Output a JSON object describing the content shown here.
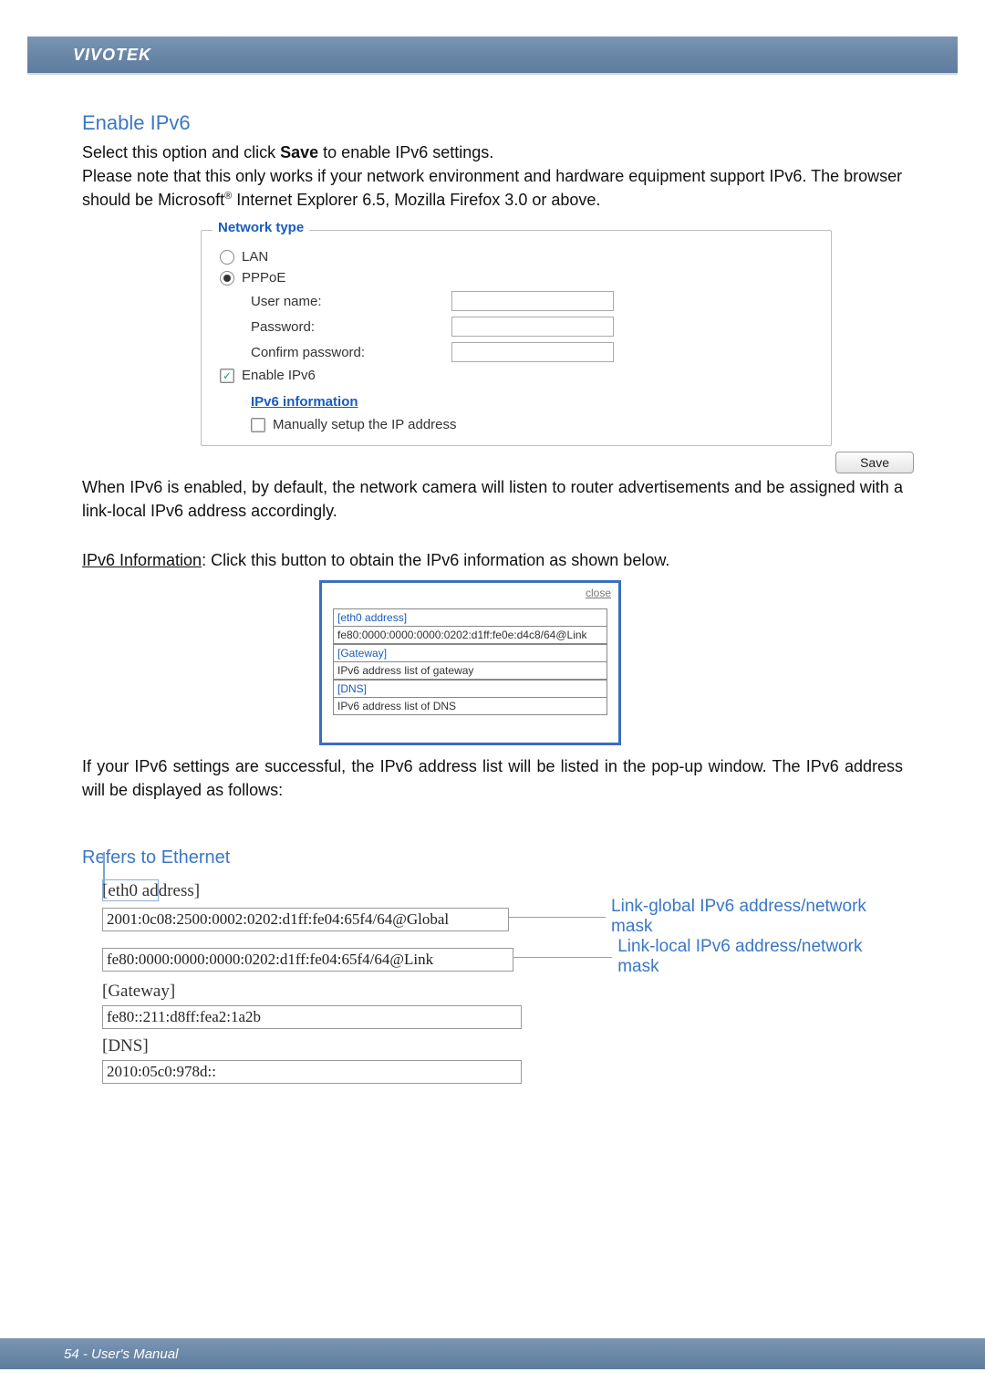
{
  "header": {
    "brand": "VIVOTEK"
  },
  "section": {
    "title": "Enable IPv6",
    "para1_a": "Select this option and click ",
    "para1_save": "Save",
    "para1_b": " to enable IPv6 settings.",
    "para2_a": "Please note that this only works if your network environment and hardware equipment support IPv6. The browser should be Microsoft",
    "para2_reg": "®",
    "para2_b": " Internet Explorer 6.5, Mozilla Firefox 3.0 or above."
  },
  "panel": {
    "legend": "Network type",
    "lan": "LAN",
    "pppoe": "PPPoE",
    "username_label": "User name:",
    "password_label": "Password:",
    "confirm_label": "Confirm password:",
    "enable_ipv6": "Enable IPv6",
    "ipv6_info_link": "IPv6 information",
    "manual_label": "Manually setup the IP address",
    "save_button": "Save"
  },
  "after_panel": {
    "para1": "When IPv6 is enabled, by default, the network camera will listen to router advertisements and be assigned with a link-local IPv6 address accordingly.",
    "para2_a": "IPv6 Information",
    "para2_b": ": Click this button to obtain the IPv6 information as shown below."
  },
  "popup": {
    "close": "close",
    "eth0": "[eth0 address]",
    "eth0_val": "fe80:0000:0000:0000:0202:d1ff:fe0e:d4c8/64@Link",
    "gateway": "[Gateway]",
    "gateway_val": "IPv6 address list of gateway",
    "dns": "[DNS]",
    "dns_val": "IPv6 address list of DNS"
  },
  "after_popup": {
    "para": "If your IPv6 settings are successful, the IPv6 address list will be listed in the pop-up window. The IPv6 address will be displayed as follows:"
  },
  "ethernet": {
    "refers": "Refers to Ethernet",
    "eth0_label": "[eth0 address]",
    "global_addr": "2001:0c08:2500:0002:0202:d1ff:fe04:65f4/64@Global",
    "link_addr": "fe80:0000:0000:0000:0202:d1ff:fe04:65f4/64@Link",
    "gateway_label": "[Gateway]",
    "gateway_addr": "fe80::211:d8ff:fea2:1a2b",
    "dns_label": "[DNS]",
    "dns_addr": "2010:05c0:978d::",
    "annot_global": "Link-global IPv6 address/network mask",
    "annot_local": "Link-local IPv6 address/network mask"
  },
  "footer": {
    "text": "54 - User's Manual"
  }
}
